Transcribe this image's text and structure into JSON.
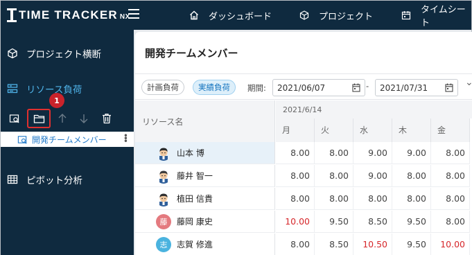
{
  "app": {
    "logo_text": "TIME TRACKER",
    "logo_suffix": "NX"
  },
  "topnav": [
    {
      "label": "ダッシュボード",
      "icon": "home-icon"
    },
    {
      "label": "プロジェクト",
      "icon": "cube-icon"
    },
    {
      "label": "タイムシート",
      "icon": "calendar-icon"
    }
  ],
  "sidebar": {
    "items": [
      {
        "label": "プロジェクト横断",
        "icon": "cube-icon"
      },
      {
        "label": "リソース負荷",
        "icon": "resource-icon",
        "active": true
      },
      {
        "label": "ピボット分析",
        "icon": "table-icon"
      }
    ],
    "tools": [
      "view-search-icon",
      "folder-icon",
      "arrow-up-icon",
      "arrow-down-icon",
      "trash-icon"
    ],
    "badge": "1",
    "tree_item": "開発チームメンバー"
  },
  "page": {
    "title": "開発チームメンバー",
    "filter": {
      "plan_chip": "計画負荷",
      "actual_chip": "実績負荷",
      "period_label": "期間:",
      "start_date": "2021/06/07",
      "separator": "-",
      "end_date": "2021/07/31"
    },
    "grid": {
      "resource_header": "リソース名",
      "week_label": "2021/6/14",
      "days": [
        "月",
        "火",
        "水",
        "木",
        "金"
      ],
      "rows": [
        {
          "name": "山本 博",
          "avatar": "photo",
          "selected": true,
          "values": [
            "8.00",
            "8.00",
            "9.00",
            "9.00",
            "8.00"
          ],
          "red": []
        },
        {
          "name": "藤井 智一",
          "avatar": "photo",
          "values": [
            "8.00",
            "8.00",
            "9.00",
            "8.00",
            "8.00"
          ],
          "red": []
        },
        {
          "name": "植田 信貴",
          "avatar": "photo",
          "values": [
            "8.00",
            "8.00",
            "8.00",
            "8.00",
            "8.00"
          ],
          "red": []
        },
        {
          "name": "藤岡 康史",
          "avatar": "藤",
          "avatar_color": "#e47a7f",
          "values": [
            "10.00",
            "9.50",
            "8.50",
            "9.50",
            "8.00"
          ],
          "red": [
            0
          ]
        },
        {
          "name": "志賀 修進",
          "avatar": "志",
          "avatar_color": "#4ab3df",
          "values": [
            "8.00",
            "8.50",
            "10.50",
            "9.50",
            "10.00"
          ],
          "red": [
            2,
            4
          ]
        }
      ]
    }
  },
  "colors": {
    "nav_bg": "#0f2a3f",
    "accent": "#4fb3e8",
    "alert": "#d6262a",
    "highlight": "#e0302f"
  }
}
